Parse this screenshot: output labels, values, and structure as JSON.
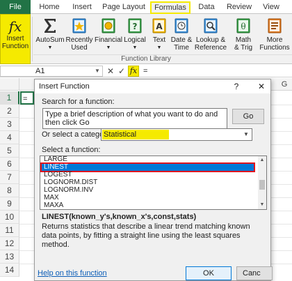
{
  "tabs": [
    "File",
    "Home",
    "Insert",
    "Page Layout",
    "Formulas",
    "Data",
    "Review",
    "View"
  ],
  "ribbon": {
    "insert_function": {
      "line1": "Insert",
      "line2": "Function"
    },
    "buttons": [
      {
        "line1": "AutoSum",
        "line2": ""
      },
      {
        "line1": "Recently",
        "line2": "Used"
      },
      {
        "line1": "Financial",
        "line2": ""
      },
      {
        "line1": "Logical",
        "line2": ""
      },
      {
        "line1": "Text",
        "line2": ""
      },
      {
        "line1": "Date &",
        "line2": "Time"
      },
      {
        "line1": "Lookup &",
        "line2": "Reference"
      },
      {
        "line1": "Math",
        "line2": "& Trig"
      },
      {
        "line1": "More",
        "line2": "Functions"
      }
    ],
    "group_label": "Function Library"
  },
  "formula_bar": {
    "name_box": "A1",
    "cancel_symbol": "✕",
    "enter_symbol": "✓",
    "fx_label": "fx",
    "formula": "="
  },
  "grid": {
    "col_visible": "G",
    "rows": [
      "1",
      "2",
      "3",
      "4",
      "5",
      "6",
      "7",
      "8",
      "9",
      "10",
      "11",
      "12",
      "13",
      "14"
    ],
    "active_cell_value": "="
  },
  "dialog": {
    "title": "Insert Function",
    "help_symbol": "?",
    "close_symbol": "✕",
    "search_label": "Search for a function:",
    "search_text": "Type a brief description of what you want to do and then click Go",
    "go_label": "Go",
    "category_label": "Or select a category:",
    "category_value": "Statistical",
    "list_label": "Select a function:",
    "functions": [
      "LARGE",
      "LINEST",
      "LOGEST",
      "LOGNORM.DIST",
      "LOGNORM.INV",
      "MAX",
      "MAXA"
    ],
    "selected_index": 1,
    "signature": "LINEST(known_y's,known_x's,const,stats)",
    "description": "Returns statistics that describe a linear trend matching known data points, by fitting a straight line using the least squares method.",
    "help_link": "Help on this function",
    "ok_label": "OK",
    "cancel_label": "Canc"
  },
  "colors": {
    "excel_green": "#217346",
    "highlight_yellow": "#f5ea00",
    "selection_blue": "#0078d7",
    "selection_outline_red": "#e0141e"
  },
  "icons": {
    "autosum": "sigma-icon",
    "recently_used": "star-book-icon",
    "financial": "financial-book-icon",
    "logical": "question-book-icon",
    "text": "text-book-icon",
    "date_time": "clock-book-icon",
    "lookup": "magnifier-book-icon",
    "math": "theta-book-icon",
    "more": "more-functions-book-icon"
  }
}
